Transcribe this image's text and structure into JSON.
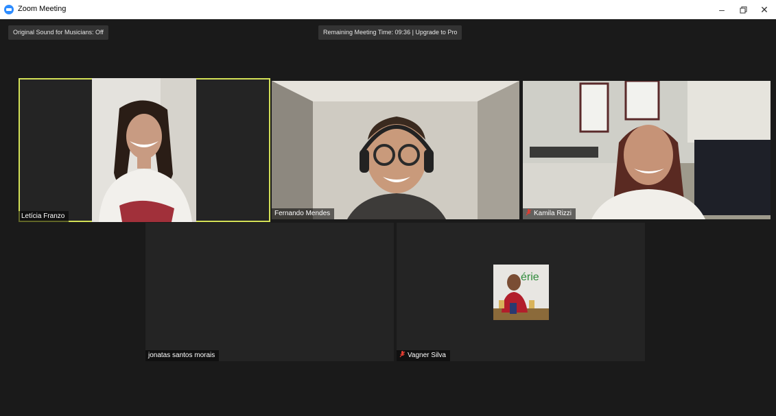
{
  "window": {
    "title": "Zoom Meeting",
    "icon": "zoom-icon"
  },
  "toolbar": {
    "sound_label": "Original Sound for Musicians: Off",
    "timer_label": "Remaining Meeting Time: 09:36 | Upgrade to Pro"
  },
  "participants": [
    {
      "name": "Letícia Franzo",
      "muted": false,
      "video": true,
      "active_speaker": true
    },
    {
      "name": "Fernando Mendes",
      "muted": false,
      "video": true,
      "active_speaker": false
    },
    {
      "name": "Kamila Rizzi",
      "muted": true,
      "video": true,
      "active_speaker": false
    },
    {
      "name": "jonatas santos morais",
      "muted": false,
      "video": false,
      "active_speaker": false
    },
    {
      "name": "Vagner Silva",
      "muted": true,
      "video": false,
      "active_speaker": false,
      "avatar_text": "érie"
    }
  ],
  "colors": {
    "active_border": "#d4e157",
    "muted_icon": "#e03c31",
    "zoom_blue": "#2D8CFF"
  }
}
